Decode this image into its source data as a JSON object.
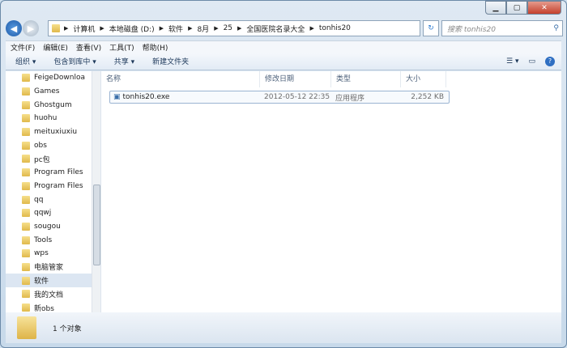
{
  "address": {
    "crumbs": [
      "计算机",
      "本地磁盘 (D:)",
      "软件",
      "8月",
      "25",
      "全国医院名录大全",
      "tonhis20"
    ]
  },
  "search": {
    "placeholder": "搜索 tonhis20"
  },
  "menu": [
    "文件(F)",
    "编辑(E)",
    "查看(V)",
    "工具(T)",
    "帮助(H)"
  ],
  "toolbar": {
    "organize": "组织 ▾",
    "include": "包含到库中 ▾",
    "share": "共享 ▾",
    "new_folder": "新建文件夹"
  },
  "sidebar": {
    "items": [
      "FeigeDownloa",
      "Games",
      "Ghostgum",
      "huohu",
      "meituxiuxiu",
      "obs",
      "pc包",
      "Program Files",
      "Program Files",
      "qq",
      "qqwj",
      "sougou",
      "Tools",
      "wps",
      "电脑管家",
      "软件",
      "我的文档",
      "新obs"
    ],
    "selected": 15
  },
  "columns": [
    "名称",
    "修改日期",
    "类型",
    "大小"
  ],
  "files": [
    {
      "name": "tonhis20.exe",
      "date": "2012-05-12 22:35",
      "type": "应用程序",
      "size": "2,252 KB"
    }
  ],
  "status": {
    "count": "1 个对象"
  }
}
